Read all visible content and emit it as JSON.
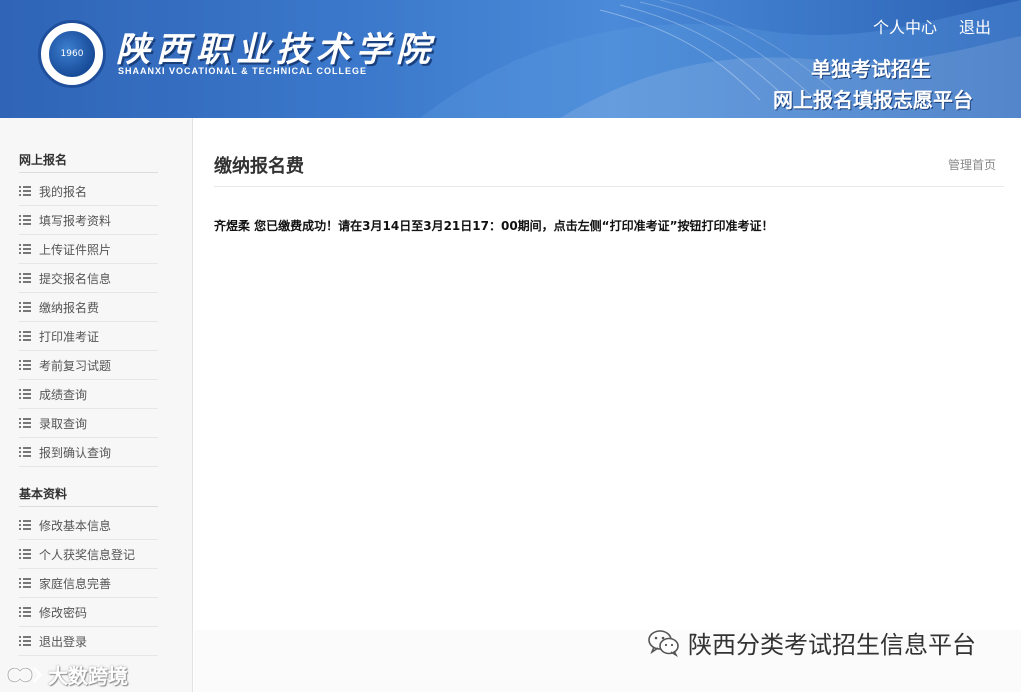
{
  "header": {
    "school_name_cn": "陕西职业技术学院",
    "school_name_en": "SHAANXI VOCATIONAL & TECHNICAL COLLEGE",
    "logo_year": "1960",
    "top_links": {
      "personal_center": "个人中心",
      "logout": "退出"
    },
    "platform_line1": "单独考试招生",
    "platform_line2": "网上报名填报志愿平台"
  },
  "sidebar": {
    "sections": [
      {
        "title": "网上报名",
        "items": [
          {
            "label": "我的报名"
          },
          {
            "label": "填写报考资料"
          },
          {
            "label": "上传证件照片"
          },
          {
            "label": "提交报名信息"
          },
          {
            "label": "缴纳报名费"
          },
          {
            "label": "打印准考证"
          },
          {
            "label": "考前复习试题"
          },
          {
            "label": "成绩查询"
          },
          {
            "label": "录取查询"
          },
          {
            "label": "报到确认查询"
          }
        ]
      },
      {
        "title": "基本资料",
        "items": [
          {
            "label": "修改基本信息"
          },
          {
            "label": "个人获奖信息登记"
          },
          {
            "label": "家庭信息完善"
          },
          {
            "label": "修改密码"
          },
          {
            "label": "退出登录"
          }
        ]
      }
    ]
  },
  "main": {
    "page_title": "缴纳报名费",
    "breadcrumb": "管理首页",
    "message": "齐煜柔 您已缴费成功！请在3月14日至3月21日17：00期间，点击左侧“打印准考证”按钮打印准考证！"
  },
  "overlays": {
    "wechat_account": "陕西分类考试招生信息平台",
    "watermark": "大数跨境"
  },
  "colors": {
    "header_blue": "#3b78cb",
    "sidebar_bg": "#f7f7f7",
    "text_dark": "#333333"
  },
  "icons": {
    "sidebar_item": "list-icon",
    "wechat": "wechat-icon",
    "watermark": "watermark-logo-icon"
  }
}
